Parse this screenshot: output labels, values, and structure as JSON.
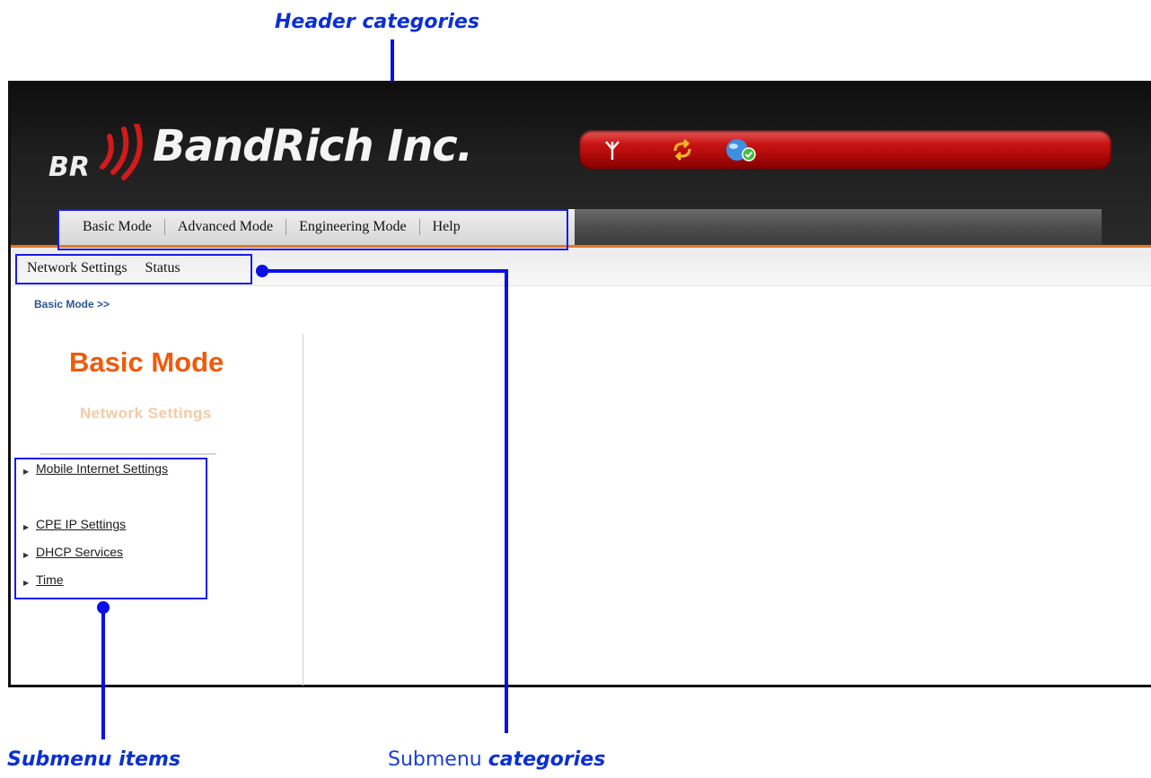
{
  "annotations": {
    "header_categories": "Header categories",
    "submenu_items": "Submenu items",
    "submenu_categories_plain": "Submenu ",
    "submenu_categories_bold": "categories"
  },
  "app": {
    "logo_text": "BandRich Inc.",
    "logo_mark": "BR"
  },
  "status_icons": [
    "antenna-icon",
    "sync-icon",
    "globe-connected-icon"
  ],
  "header_nav": [
    "Basic Mode",
    "Advanced Mode",
    "Engineering Mode",
    "Help"
  ],
  "submenu_categories": [
    "Network Settings",
    "Status"
  ],
  "breadcrumb": "Basic Mode >>",
  "sidebar": {
    "title": "Basic Mode",
    "subtitle": "Network Settings",
    "items": [
      "Mobile Internet Settings",
      "CPE IP Settings",
      "DHCP Services",
      "Time"
    ]
  },
  "colors": {
    "annotation_blue": "#0a10e6",
    "accent_orange": "#f05a0a",
    "status_red": "#c91414"
  }
}
